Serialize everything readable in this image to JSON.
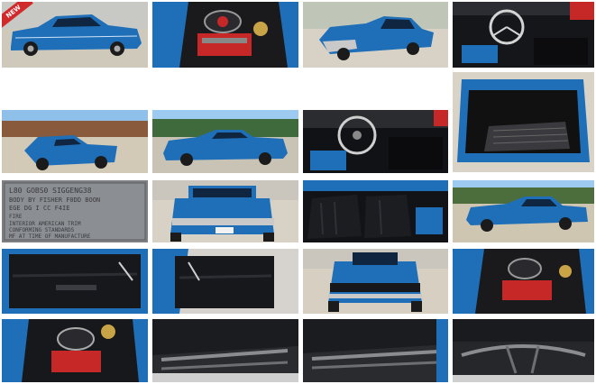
{
  "colors": {
    "car_blue": "#1f6fb8",
    "car_blue_dark": "#123f70",
    "sky": "#8fc0ea",
    "ground_light": "#d8d2c6",
    "interior": "#1a1a1d",
    "badge_red": "#d12a2a"
  },
  "badge": {
    "label": "NEW"
  },
  "plate": {
    "lines": [
      "L80  GOBS0  SIGGENG38",
      "BODY BY FISHER  F0DD  BOON",
      "EGE DG I    CC  F4IE",
      "FIRE",
      "INTERIOR AMERICAN TRIM",
      "CONFORMING STANDARDS",
      "MF AT TIME OF MANUFACTURE"
    ]
  },
  "thumbnails": [
    {
      "name": "thumb-front-side",
      "scene": "side-front"
    },
    {
      "name": "thumb-engine-bay",
      "scene": "engine"
    },
    {
      "name": "thumb-front-three-quarter",
      "scene": "front-three-quarter"
    },
    {
      "name": "thumb-steering-interior",
      "scene": "interior-wheel"
    },
    {
      "name": "thumb-bed-overhead",
      "scene": "bed"
    },
    {
      "name": "thumb-rear-quarter",
      "scene": "rear-quarter"
    },
    {
      "name": "thumb-front-profile",
      "scene": "front-profile"
    },
    {
      "name": "thumb-dash",
      "scene": "dash"
    },
    {
      "name": "thumb-bed-liner",
      "scene": "bed-liner"
    },
    {
      "name": "thumb-vin-plate",
      "scene": "plate"
    },
    {
      "name": "thumb-rear-view",
      "scene": "rear"
    },
    {
      "name": "thumb-seats",
      "scene": "seats"
    },
    {
      "name": "thumb-side-profile",
      "scene": "side-profile"
    },
    {
      "name": "thumb-door-panel-left",
      "scene": "door"
    },
    {
      "name": "thumb-door-panel-right",
      "scene": "door2"
    },
    {
      "name": "thumb-front-grille",
      "scene": "front"
    },
    {
      "name": "thumb-engine-right",
      "scene": "engine2"
    },
    {
      "name": "thumb-engine-top",
      "scene": "engine3"
    },
    {
      "name": "thumb-undercarriage-1",
      "scene": "under"
    },
    {
      "name": "thumb-undercarriage-2",
      "scene": "under2"
    },
    {
      "name": "thumb-undercarriage-3",
      "scene": "under3"
    }
  ]
}
